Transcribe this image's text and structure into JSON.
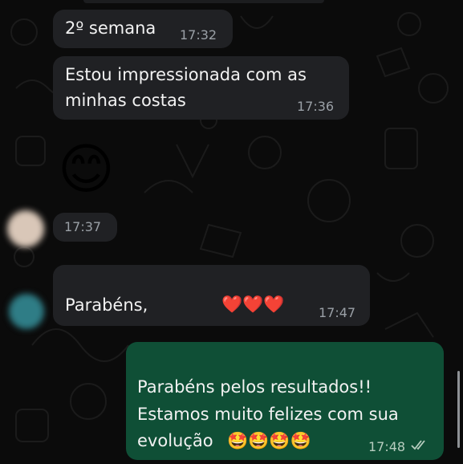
{
  "messages": [
    {
      "direction": "incoming",
      "text": "2º semana",
      "time": "17:32"
    },
    {
      "direction": "incoming",
      "text_line1": "Estou impressionada com as",
      "text_line2": "minhas costas",
      "time": "17:36"
    },
    {
      "direction": "incoming",
      "kind": "emoji",
      "emoji": "😊",
      "emoji_icon": "smiling-face-emoji"
    },
    {
      "direction": "incoming",
      "time": "17:37"
    },
    {
      "direction": "incoming",
      "text": "Parabéns,",
      "hearts": "❤️❤️❤️",
      "time": "17:47"
    },
    {
      "direction": "outgoing",
      "text_line1": "Parabéns pelos resultados!!",
      "text_line2": "Estamos muito felizes com sua",
      "text_line3": "evolução",
      "emojis": "🤩🤩🤩🤩",
      "time": "17:48",
      "status_icon": "double-check-icon"
    }
  ],
  "colors": {
    "background": "#0b0b0b",
    "incoming_bubble": "#202124",
    "outgoing_bubble": "#0f4f36",
    "text": "#f2f2f2",
    "timestamp": "#9aa0a6"
  }
}
